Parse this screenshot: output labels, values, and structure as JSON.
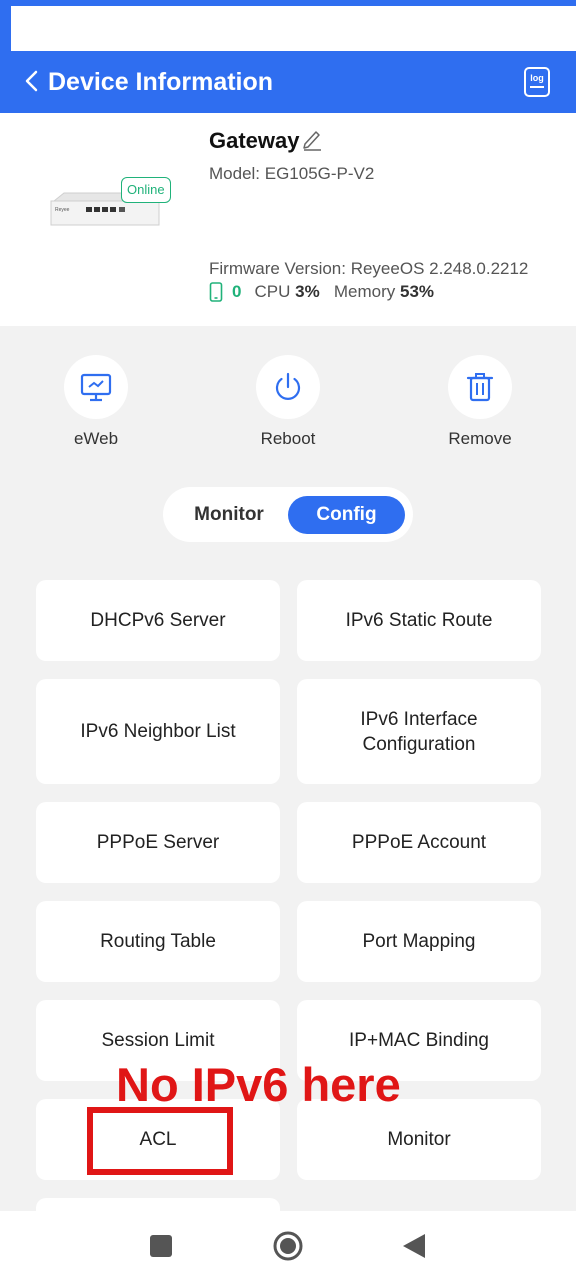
{
  "header": {
    "title": "Device Information",
    "back_icon": "chevron-left-icon",
    "log_icon": "log-icon",
    "log_label": "log"
  },
  "device": {
    "name": "Gateway",
    "model": "Model: EG105G-P-V2",
    "status": "Online",
    "brand_label": "Reyee",
    "firmware": "Firmware Version: ReyeeOS 2.248.0.2212",
    "clients": "0",
    "cpu_label": "CPU",
    "cpu_value": "3%",
    "memory_label": "Memory",
    "memory_value": "53%"
  },
  "actions": [
    {
      "label": "eWeb",
      "icon": "monitor-icon"
    },
    {
      "label": "Reboot",
      "icon": "power-icon"
    },
    {
      "label": "Remove",
      "icon": "trash-icon"
    }
  ],
  "tabs": {
    "monitor": "Monitor",
    "config": "Config",
    "active": "Config"
  },
  "menu": [
    "DHCPv6 Server",
    "IPv6 Static Route",
    "IPv6 Neighbor List",
    "IPv6 Interface Configuration",
    "PPPoE Server",
    "PPPoE Account",
    "Routing Table",
    "Port Mapping",
    "Session Limit",
    "IP+MAC Binding",
    "ACL",
    "Monitor"
  ],
  "annotation": {
    "text": "No IPv6 here"
  },
  "colors": {
    "primary": "#2f6ef0",
    "online": "#20b27a",
    "annotation": "#e01616"
  }
}
